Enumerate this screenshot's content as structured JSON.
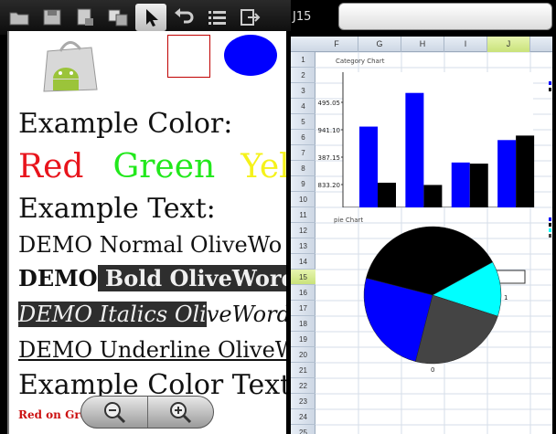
{
  "toolbar": {
    "buttons": [
      {
        "name": "open-folder-icon"
      },
      {
        "name": "save-icon"
      },
      {
        "name": "page-icon"
      },
      {
        "name": "translate-icon"
      },
      {
        "name": "pointer-icon",
        "active": true
      },
      {
        "name": "undo-icon"
      },
      {
        "name": "list-icon"
      },
      {
        "name": "exit-icon"
      }
    ]
  },
  "document": {
    "lines": {
      "color_heading": "Example Color:",
      "color_red": "Red",
      "color_green": "Green",
      "color_yellow": "Yel",
      "text_heading": "Example Text:",
      "normal": "DEMO Normal OliveWo",
      "bold_a": "DEMO",
      "bold_b": " Bold OliveWord",
      "italic_a": "DEMO ",
      "italic_b": "Italics Oli",
      "italic_c": "veWord",
      "underline": "DEMO Underline OliveW",
      "color_text_heading": "Example Color Text:",
      "red_on_green": "Red on Gre"
    },
    "colors": {
      "red": "#e8141c",
      "green": "#22e81c",
      "yellow": "#f5f21a",
      "square_border": "#c00000",
      "oval": "#0000ff"
    }
  },
  "zoom": {
    "out_icon": "zoom-out-icon",
    "in_icon": "zoom-in-icon"
  },
  "sheet": {
    "cell_ref": "J15",
    "columns": [
      "F",
      "G",
      "H",
      "I",
      "J"
    ],
    "selected_column": "J",
    "rows": [
      "1",
      "2",
      "3",
      "4",
      "5",
      "6",
      "7",
      "8",
      "9",
      "10",
      "11",
      "12",
      "13",
      "14",
      "15",
      "16",
      "17",
      "18",
      "19",
      "20",
      "21",
      "22",
      "23",
      "24",
      "25"
    ],
    "selected_row": "15"
  },
  "chart_data": [
    {
      "type": "bar",
      "title": "Category Chart",
      "categories": [
        "1",
        "2",
        "3",
        "4",
        "5"
      ],
      "y_ticks": [
        "495.05",
        "941.10",
        "387.15",
        "833.20",
        "279.25"
      ],
      "series": [
        {
          "name": "1",
          "color": "#0000ff",
          "values": [
            0.72,
            1.02,
            0.4,
            0.6
          ]
        },
        {
          "name": "2",
          "color": "#000000",
          "values": [
            0.22,
            0.2,
            0.39,
            0.64
          ]
        }
      ],
      "legend": "top-right"
    },
    {
      "type": "pie",
      "title": "pie Chart",
      "legend_entries": [
        {
          "name": "0",
          "color": "#0000ff"
        },
        {
          "name": "1",
          "color": "#000000"
        },
        {
          "name": "2",
          "color": "#00ffff"
        },
        {
          "name": "3",
          "color": "#444444"
        }
      ],
      "slices": [
        {
          "label": "black",
          "value": 38,
          "color": "#000000"
        },
        {
          "label": "cyan",
          "value": 13,
          "color": "#00ffff"
        },
        {
          "label": "gray",
          "value": 24,
          "color": "#444444"
        },
        {
          "label": "blue",
          "value": 25,
          "color": "#0000ff"
        }
      ],
      "slice_labels": [
        "0",
        "1"
      ],
      "legend": "top-right"
    }
  ]
}
